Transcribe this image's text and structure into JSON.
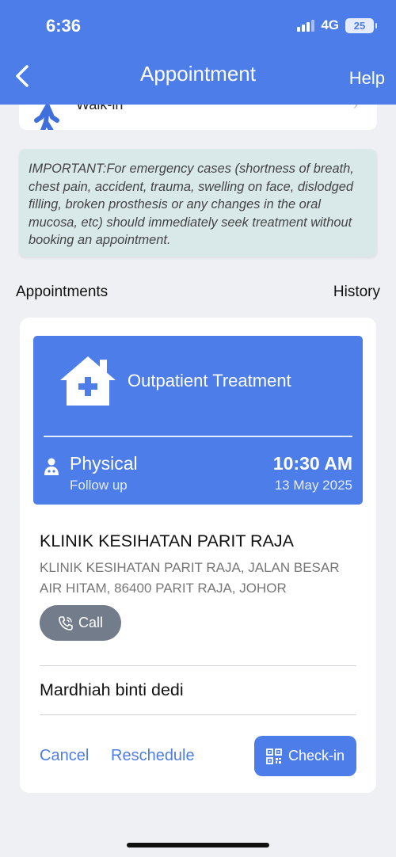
{
  "status_bar": {
    "time": "6:36",
    "network": "4G",
    "battery": "25"
  },
  "header": {
    "title": "Appointment",
    "help_label": "Help"
  },
  "walkin": {
    "label": "Walk-in"
  },
  "notice": {
    "text": "IMPORTANT:For emergency cases (shortness of breath, chest pain, accident, trauma, swelling on face, dislodged filling, broken prosthesis or any changes in the oral mucosa, etc) should immediately seek treatment without booking an appointment."
  },
  "sections": {
    "appointments": "Appointments",
    "history": "History"
  },
  "appointment": {
    "treatment": "Outpatient Treatment",
    "mode": "Physical",
    "visit_type": "Follow up",
    "time": "10:30 AM",
    "date": "13 May 2025",
    "clinic_name": "KLINIK KESIHATAN PARIT RAJA",
    "clinic_address": "KLINIK KESIHATAN PARIT RAJA, JALAN BESAR AIR HITAM, 86400 PARIT RAJA, JOHOR",
    "call_label": "Call",
    "patient_name": "Mardhiah binti dedi",
    "cancel_label": "Cancel",
    "reschedule_label": "Reschedule",
    "checkin_label": "Check-in"
  },
  "colors": {
    "primary": "#4d7de8",
    "notice_bg": "#d9e9ea",
    "call_button": "#727c8a"
  }
}
